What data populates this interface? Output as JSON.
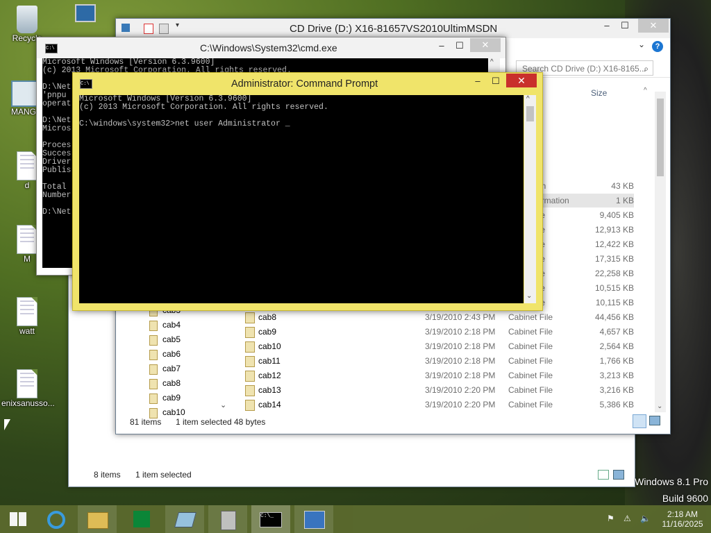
{
  "desktop_icons": [
    {
      "label": "Recycle",
      "icon": "recycle-bin-icon"
    },
    {
      "label": "MANG",
      "icon": "app-icon"
    },
    {
      "label": "d",
      "icon": "document-icon"
    },
    {
      "label": "M",
      "icon": "document-icon"
    },
    {
      "label": "watt",
      "icon": "document-icon"
    },
    {
      "label": "enixsanusso...",
      "icon": "document-icon"
    }
  ],
  "explorer_back": {
    "status_items": "8 items",
    "status_selected": "1 item selected"
  },
  "explorer": {
    "title": "CD Drive (D:) X16-81657VS2010UltimMSDN",
    "search_placeholder": "Search CD Drive (D:) X16-8165...",
    "size_header": "Size",
    "partial_rows": [
      {
        "type_fragment": "on",
        "size": "43 KB"
      },
      {
        "type_fragment": "ormation",
        "size": "1 KB"
      },
      {
        "type_fragment": "ile",
        "size": "9,405 KB"
      },
      {
        "type_fragment": "ile",
        "size": "12,913 KB"
      },
      {
        "type_fragment": "ile",
        "size": "12,422 KB"
      },
      {
        "type_fragment": "ile",
        "size": "17,315 KB"
      },
      {
        "type_fragment": "ile",
        "size": "22,258 KB"
      },
      {
        "type_fragment": "ile",
        "size": "10,515 KB"
      },
      {
        "type_fragment": "ile",
        "size": "10,115 KB"
      }
    ],
    "files": [
      {
        "name": "cab8",
        "date": "3/19/2010 2:43 PM",
        "type": "Cabinet File",
        "size": "44,456 KB"
      },
      {
        "name": "cab9",
        "date": "3/19/2010 2:18 PM",
        "type": "Cabinet File",
        "size": "4,657 KB"
      },
      {
        "name": "cab10",
        "date": "3/19/2010 2:18 PM",
        "type": "Cabinet File",
        "size": "2,564 KB"
      },
      {
        "name": "cab11",
        "date": "3/19/2010 2:18 PM",
        "type": "Cabinet File",
        "size": "1,766 KB"
      },
      {
        "name": "cab12",
        "date": "3/19/2010 2:18 PM",
        "type": "Cabinet File",
        "size": "3,213 KB"
      },
      {
        "name": "cab13",
        "date": "3/19/2010 2:20 PM",
        "type": "Cabinet File",
        "size": "3,216 KB"
      },
      {
        "name": "cab14",
        "date": "3/19/2010 2:20 PM",
        "type": "Cabinet File",
        "size": "5,386 KB"
      }
    ],
    "tree": [
      "cab3",
      "cab4",
      "cab5",
      "cab6",
      "cab7",
      "cab8",
      "cab9",
      "cab10"
    ],
    "status_items": "81 items",
    "status_selected": "1 item selected",
    "status_size": "48 bytes"
  },
  "cmd_back": {
    "title": "C:\\Windows\\System32\\cmd.exe",
    "text": "Microsoft Windows [Version 6.3.9600]\n(c) 2013 Microsoft Corporation. All rights reserved.\n\nD:\\Net\n'pnpu\noperat\n\nD:\\Net\nMicros\n\nProces\nSucces\nDriver\nPublis\n\nTotal\nNumber\n\nD:\\Net"
  },
  "cmd_admin": {
    "title": "Administrator: Command Prompt",
    "text": "Microsoft Windows [Version 6.3.9600]\n(c) 2013 Microsoft Corporation. All rights reserved.\n\nC:\\windows\\system32>net user Administrator _"
  },
  "watermark": {
    "line1": "Windows 8.1 Pro",
    "line2": "Build 9600"
  },
  "taskbar": {
    "items": [
      "start-button",
      "internet-explorer-icon",
      "file-explorer-icon",
      "store-icon",
      "notebook-icon",
      "network-tool-icon",
      "command-prompt-icon",
      "setup-icon"
    ],
    "time": "2:18 AM",
    "date": "11/16/2025"
  }
}
